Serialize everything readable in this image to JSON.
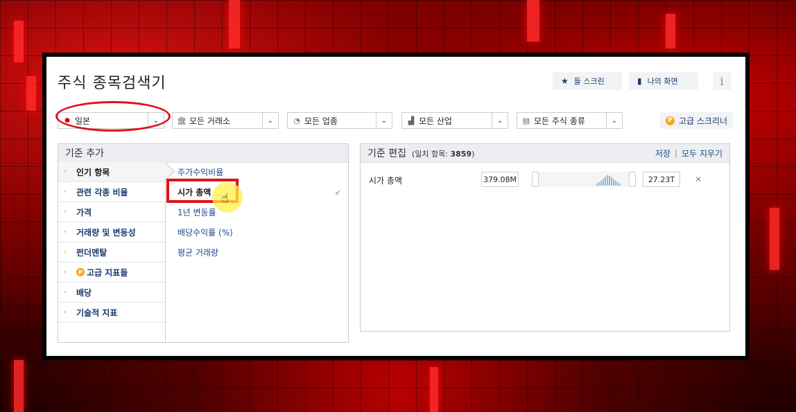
{
  "title": "주식 종목검색기",
  "top_buttons": {
    "my_screens": {
      "label": "들 스크린",
      "icon": "star-icon"
    },
    "my_views": {
      "label": "나의 화면",
      "icon": "bookmark-icon"
    },
    "info": {
      "label": "i"
    }
  },
  "filters": {
    "country": {
      "label": "일본",
      "icon": "red-dot"
    },
    "exchange": {
      "label": "모든 거래소",
      "icon": "bank-icon"
    },
    "sector": {
      "label": "모든 업종",
      "icon": "pie-icon"
    },
    "industry": {
      "label": "모든 산업",
      "icon": "factory-icon"
    },
    "equity_type": {
      "label": "모든 주식 종류",
      "icon": "document-icon"
    }
  },
  "advanced_screener": {
    "label": "고급 스크리너",
    "badge": "P"
  },
  "add_criteria": {
    "header": "기준 추가",
    "categories": [
      {
        "label": "인기 항목",
        "active": true
      },
      {
        "label": "관련 각종 비율"
      },
      {
        "label": "가격"
      },
      {
        "label": "거래량 및 변동성"
      },
      {
        "label": "펀더멘탈"
      },
      {
        "label": "고급 지표들",
        "badge": "P"
      },
      {
        "label": "배당"
      },
      {
        "label": "기술적 지표"
      }
    ],
    "items": [
      {
        "label": "주가수익비율"
      },
      {
        "label": "시가 총액",
        "selected": true
      },
      {
        "label": "1년 변동률"
      },
      {
        "label": "배당수익률 (%)"
      },
      {
        "label": "평균 거래량"
      }
    ],
    "check_glyph": "✔"
  },
  "edit_criteria": {
    "header": "기준 편집",
    "match_label": "(일치 항목: ",
    "match_count": "3859",
    "match_close": ")",
    "save": "저장",
    "separator": "|",
    "clear_all": "모두 지우기",
    "rows": [
      {
        "label": "시가 총액",
        "min": "379.08M",
        "max": "27.23T",
        "remove": "✕"
      }
    ]
  },
  "colors": {
    "accent": "#1a3a6a",
    "highlight_red": "#e0121a",
    "badge_orange": "#f3a91b"
  }
}
